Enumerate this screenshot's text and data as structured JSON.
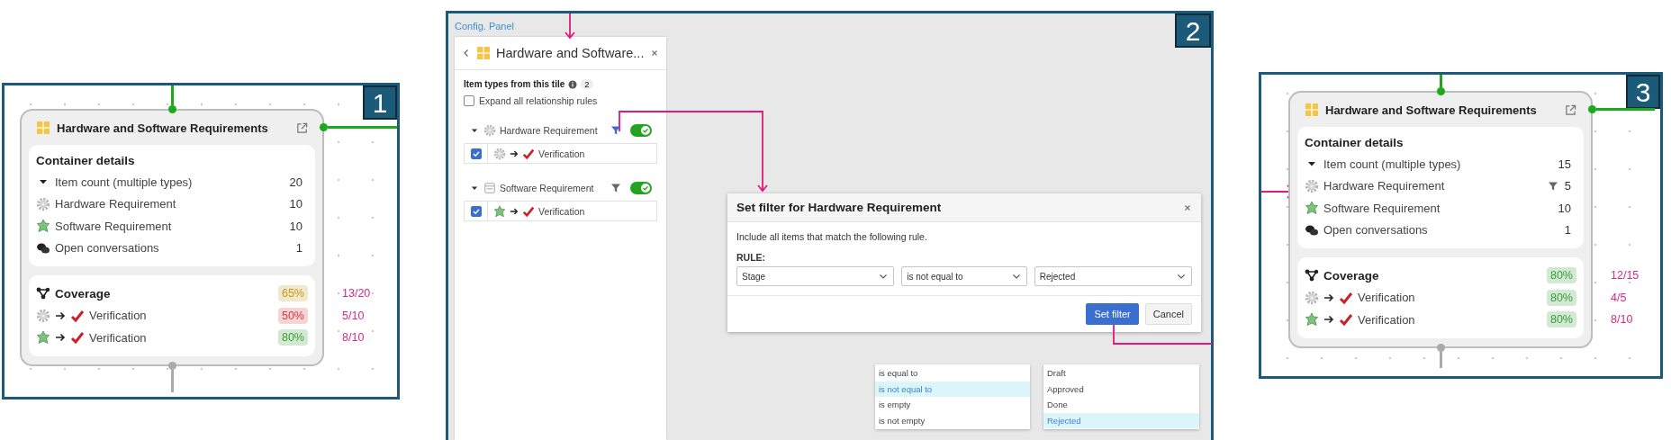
{
  "panels": [
    {
      "kind": "tile",
      "number": "1",
      "tile": {
        "title": "Hardware and Software Requirements",
        "details_heading": "Container details",
        "item_count": {
          "label": "Item count (multiple types)",
          "value": "20",
          "expanded": true
        },
        "rows": [
          {
            "kind": "hardware",
            "label": "Hardware Requirement",
            "value": "10",
            "filtered": false
          },
          {
            "kind": "software",
            "label": "Software Requirement",
            "value": "10",
            "filtered": false
          },
          {
            "kind": "conversations",
            "label": "Open conversations",
            "value": "1",
            "filtered": false
          }
        ],
        "coverage": {
          "label": "Coverage",
          "badge": "65%",
          "color": "#c49a1a",
          "ratio": "13/20"
        },
        "coverage_rows": [
          {
            "kind": "hardware",
            "label": "Verification",
            "badge": "50%",
            "color": "#d63a3f",
            "ratio": "5/10"
          },
          {
            "kind": "software",
            "label": "Verification",
            "badge": "80%",
            "color": "#3a9c3a",
            "ratio": "8/10"
          }
        ]
      }
    },
    {
      "kind": "config",
      "number": "2",
      "label": "Config. Panel",
      "sidebar": {
        "title": "Hardware and Software...",
        "section_heading": "Item types from this tile",
        "count": "2",
        "expand_all": {
          "label": "Expand all relationship rules",
          "checked": false
        },
        "item_types": [
          {
            "kind": "hardware",
            "label": "Hardware Requirement",
            "filter_active": true,
            "enabled": true,
            "expanded": true,
            "rules": [
              {
                "checked": true,
                "label": "Verification"
              }
            ]
          },
          {
            "kind": "software",
            "label": "Software Requirement",
            "filter_active": false,
            "enabled": true,
            "expanded": true,
            "rules": [
              {
                "checked": true,
                "label": "Verification"
              }
            ]
          }
        ]
      },
      "dialog": {
        "title": "Set filter for Hardware Requirement",
        "description": "Include all items that match the following rule.",
        "rule_label": "RULE:",
        "selects": [
          {
            "value": "Stage"
          },
          {
            "value": "is not equal to"
          },
          {
            "value": "Rejected"
          }
        ],
        "buttons": [
          {
            "label": "Set filter",
            "kind": "primary"
          },
          {
            "label": "Cancel",
            "kind": "secondary"
          }
        ]
      },
      "open_menus": [
        {
          "options": [
            {
              "label": "is equal to",
              "selected": false
            },
            {
              "label": "is not equal to",
              "selected": true
            },
            {
              "label": "is empty",
              "selected": false
            },
            {
              "label": "is not empty",
              "selected": false
            }
          ]
        },
        {
          "options": [
            {
              "label": "Draft",
              "selected": false
            },
            {
              "label": "Approved",
              "selected": false
            },
            {
              "label": "Done",
              "selected": false
            },
            {
              "label": "Rejected",
              "selected": true
            }
          ]
        }
      ]
    },
    {
      "kind": "tile",
      "number": "3",
      "tile": {
        "title": "Hardware and Software Requirements",
        "details_heading": "Container details",
        "item_count": {
          "label": "Item count (multiple types)",
          "value": "15",
          "expanded": true
        },
        "rows": [
          {
            "kind": "hardware",
            "label": "Hardware Requirement",
            "value": "5",
            "filtered": true
          },
          {
            "kind": "software",
            "label": "Software Requirement",
            "value": "10",
            "filtered": false
          },
          {
            "kind": "conversations",
            "label": "Open conversations",
            "value": "1",
            "filtered": false
          }
        ],
        "coverage": {
          "label": "Coverage",
          "badge": "80%",
          "color": "#3a9c3a",
          "ratio": "12/15"
        },
        "coverage_rows": [
          {
            "kind": "hardware",
            "label": "Verification",
            "badge": "80%",
            "color": "#3a9c3a",
            "ratio": "4/5"
          },
          {
            "kind": "software",
            "label": "Verification",
            "badge": "80%",
            "color": "#3a9c3a",
            "ratio": "8/10"
          }
        ]
      }
    }
  ]
}
